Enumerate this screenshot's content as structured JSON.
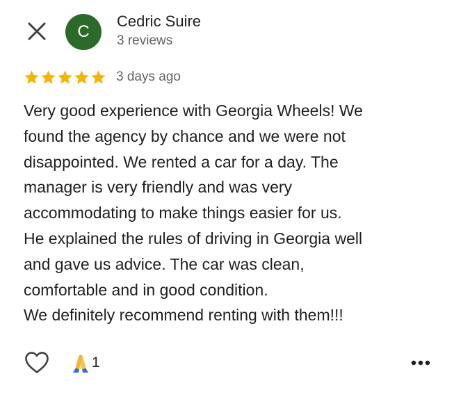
{
  "author": {
    "initial": "C",
    "name": "Cedric Suire",
    "meta": "3 reviews",
    "avatar_color": "#2c6a2a"
  },
  "review": {
    "rating": 5,
    "rating_max": 5,
    "star_color": "#f4b400",
    "time": "3 days ago",
    "lines": [
      "Very good experience with Georgia Wheels!  We",
      "found the agency by chance and we were not",
      "disappointed.  We rented a car for a day.  The",
      "manager is very friendly and was very",
      "accommodating to make things easier for us.",
      "He explained the rules of driving in Georgia well",
      "and gave us advice.  The car was clean,",
      "comfortable and in good condition.",
      "We definitely recommend renting with them!!!"
    ]
  },
  "actions": {
    "close_icon": "close-icon",
    "like_icon": "heart-outline-icon",
    "reaction_icon": "folded-hands-emoji",
    "reaction_count": "1",
    "more_icon": "more-horizontal-icon"
  }
}
